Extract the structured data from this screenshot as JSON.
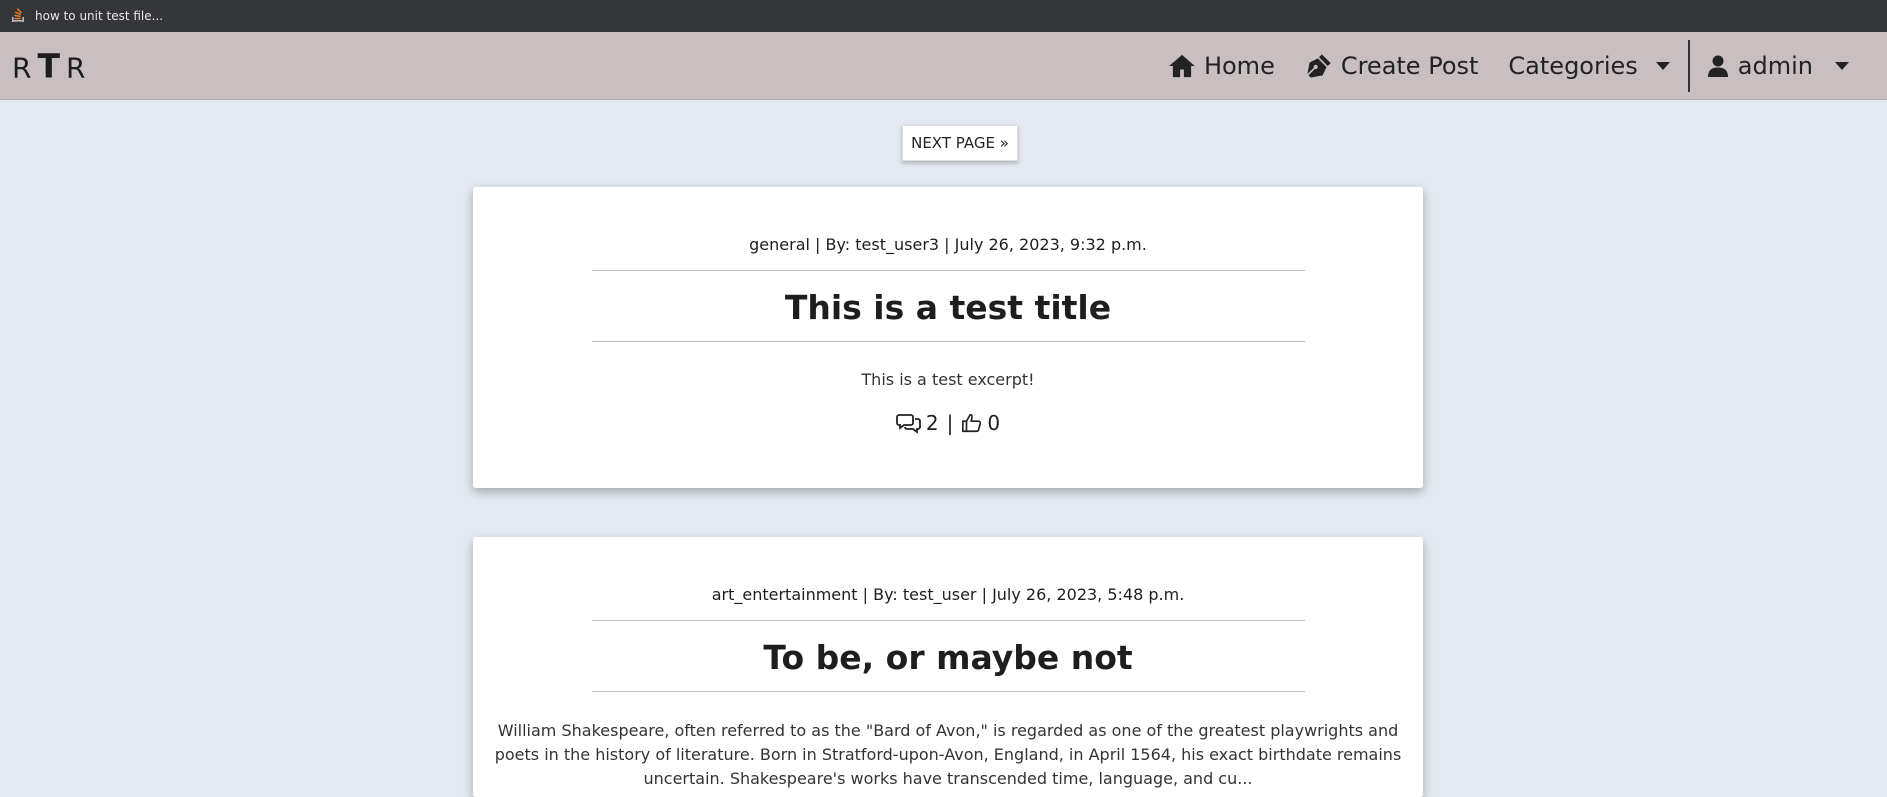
{
  "bookmarks": [
    {
      "label": "how to unit test file...",
      "icon": "stackoverflow-icon"
    }
  ],
  "navbar": {
    "brand_left": "R",
    "brand_mid": "T",
    "brand_right": "R",
    "home_label": "Home",
    "create_post_label": "Create Post",
    "categories_label": "Categories",
    "user_label": "admin"
  },
  "pagination": {
    "next_label": "NEXT PAGE »"
  },
  "posts": [
    {
      "meta": "general | By: test_user3 | July 26, 2023, 9:32 p.m.",
      "title": "This is a test title",
      "excerpt": "This is a test excerpt!",
      "comments": "2",
      "likes": "0"
    },
    {
      "meta": "art_entertainment | By: test_user | July 26, 2023, 5:48 p.m.",
      "title": "To be, or maybe not",
      "excerpt": "William Shakespeare, often referred to as the \"Bard of Avon,\" is regarded as one of the greatest playwrights and poets in the history of literature. Born in Stratford-upon-Avon, England, in April 1564, his exact birthdate remains uncertain. Shakespeare's works have transcended time, language, and cu..."
    }
  ],
  "colors": {
    "bookmarks_bg": "#35363a",
    "navbar_bg": "#cabfc0",
    "page_bg": "#e3e9f0",
    "card_bg": "#ffffff"
  }
}
